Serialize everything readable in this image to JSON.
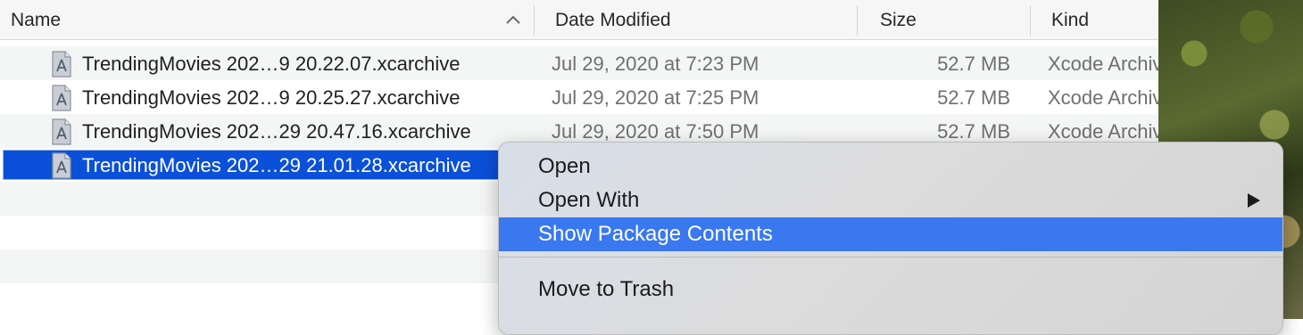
{
  "columns": {
    "name": "Name",
    "date": "Date Modified",
    "size": "Size",
    "kind": "Kind"
  },
  "rows": [
    {
      "name": "TrendingMovies 202…9 20.22.07.xcarchive",
      "date": "Jul 29, 2020 at 7:23 PM",
      "size": "52.7 MB",
      "kind": "Xcode Archive"
    },
    {
      "name": "TrendingMovies 202…9 20.25.27.xcarchive",
      "date": "Jul 29, 2020 at 7:25 PM",
      "size": "52.7 MB",
      "kind": "Xcode Archive"
    },
    {
      "name": "TrendingMovies 202…29 20.47.16.xcarchive",
      "date": "Jul 29, 2020 at 7:50 PM",
      "size": "52.7 MB",
      "kind": "Xcode Archive"
    },
    {
      "name": "TrendingMovies 202…29 21.01.28.xcarchive",
      "date": "",
      "size": "",
      "kind": ""
    }
  ],
  "context_menu": {
    "items": [
      {
        "label": "Open"
      },
      {
        "label": "Open With"
      },
      {
        "label": "Show Package Contents"
      },
      {
        "label": "Move to Trash"
      }
    ]
  },
  "icons": {
    "sort": "chevron-up-icon",
    "file": "xcarchive-file-icon",
    "submenu": "triangle-right-icon"
  },
  "colors": {
    "selection": "#0a50d8",
    "menu_highlight": "#3a78f0"
  }
}
